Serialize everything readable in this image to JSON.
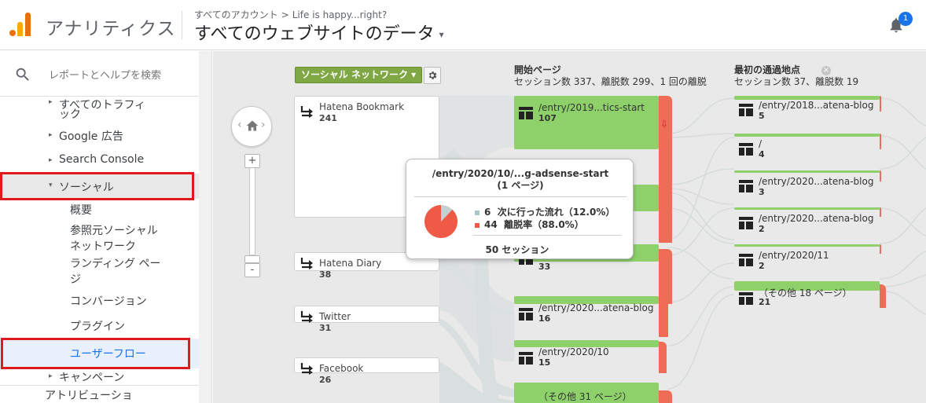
{
  "header": {
    "app_title": "アナリティクス",
    "breadcrumb_account": "すべてのアカウント",
    "breadcrumb_sep": ">",
    "breadcrumb_property": "Life is happy...right?",
    "view_title": "すべてのウェブサイトのデータ",
    "view_caret": "▾",
    "notification_count": "1"
  },
  "sidebar": {
    "search_placeholder": "レポートとヘルプを検索",
    "items": [
      {
        "arrow": "▸",
        "label": "すべてのトラフィ"
      },
      {
        "label": "ック"
      },
      {
        "arrow": "▸",
        "label": "Google 広告"
      },
      {
        "arrow": "▸",
        "label": "Search Console"
      },
      {
        "arrow": "▾",
        "label": "ソーシャル"
      },
      {
        "label": "概要"
      },
      {
        "label": "参照元ソーシャル"
      },
      {
        "label": "ネットワーク"
      },
      {
        "label": "ランディング ペー"
      },
      {
        "label": "ジ"
      },
      {
        "label": "コンバージョン"
      },
      {
        "label": "プラグイン"
      },
      {
        "label": "ユーザーフロー"
      },
      {
        "arrow": "▸",
        "label": "キャンペーン"
      },
      {
        "label": "アトリビューショ"
      }
    ]
  },
  "flow": {
    "dimension_select": "ソーシャル ネットワーク ▾",
    "columns": [
      {
        "title": "開始ページ",
        "subtitle": "セッション数 337、離脱数 299、1 回の離脱"
      },
      {
        "title": "最初の通過地点",
        "subtitle": "セッション数 37、離脱数 19"
      }
    ],
    "close_symbol": "×",
    "zoom_in": "+",
    "zoom_out": "-",
    "nav_left": "‹",
    "nav_right": "›",
    "sources": [
      {
        "name": "Hatena Bookmark",
        "count": "241"
      },
      {
        "name": "Hatena Diary",
        "count": "38"
      },
      {
        "name": "Twitter",
        "count": "31"
      },
      {
        "name": "Facebook",
        "count": "26"
      }
    ],
    "start_pages": [
      {
        "name": "/entry/2019...tics-start",
        "count": "107"
      },
      {
        "name": "",
        "count": ""
      },
      {
        "name": "",
        "count": "33"
      },
      {
        "name": "/entry/2020...atena-blog",
        "count": "16"
      },
      {
        "name": "/entry/2020/10",
        "count": "15"
      },
      {
        "name": "（その他 31 ページ）",
        "count": ""
      }
    ],
    "drop_arrow": "⇩",
    "interactions": [
      {
        "name": "/entry/2018...atena-blog",
        "count": "5"
      },
      {
        "name": "/",
        "count": "4"
      },
      {
        "name": "/entry/2020...atena-blog",
        "count": "3"
      },
      {
        "name": "/entry/2020...atena-blog",
        "count": "2"
      },
      {
        "name": "/entry/2020/11",
        "count": "2"
      },
      {
        "name": "（その他 18 ページ）",
        "count": "21"
      }
    ],
    "tooltip": {
      "title_line1": "/entry/2020/10/...g-adsense-start",
      "title_line2": "(1 ページ)",
      "next_count": "6",
      "next_label": "次に行った流れ（12.0%）",
      "exit_count": "44",
      "exit_label": "離脱率（88.0%）",
      "total": "50  セッション",
      "next_share": 0.12,
      "exit_share": 0.88
    }
  },
  "colors": {
    "node_green": "#8ed16b",
    "drop_red": "#ef6c57",
    "highlight_red": "#e0191f",
    "accent_blue": "#1a73e8"
  }
}
